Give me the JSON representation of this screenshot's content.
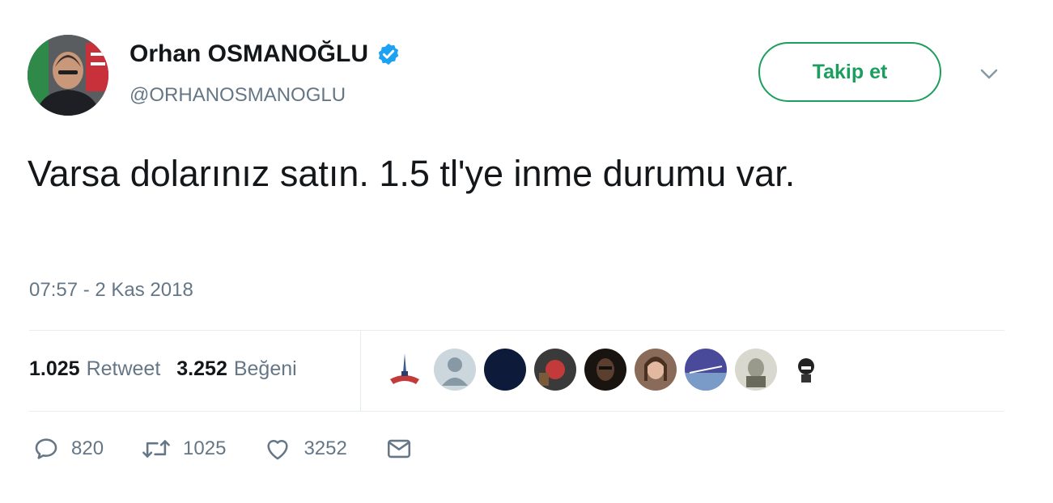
{
  "user": {
    "display_name": "Orhan OSMANOĞLU",
    "handle": "@ORHANOSMANOGLU",
    "verified": true
  },
  "follow_button": {
    "label": "Takip et"
  },
  "tweet": {
    "text": "Varsa dolarınız satın. 1.5 tl'ye inme durumu var.",
    "timestamp": "07:57 - 2 Kas 2018"
  },
  "stats": {
    "retweet_count": "1.025",
    "retweet_label": "Retweet",
    "like_count": "3.252",
    "like_label": "Beğeni"
  },
  "actions": {
    "reply_count": "820",
    "retweet_count": "1025",
    "like_count": "3252"
  },
  "colors": {
    "follow_green": "#1b9e5e",
    "verified_blue": "#1da1f2",
    "muted_text": "#657786",
    "divider": "#e6ecf0"
  },
  "icons": [
    "verified-badge-icon",
    "chevron-down-icon",
    "reply-icon",
    "retweet-icon",
    "heart-icon",
    "envelope-icon"
  ]
}
